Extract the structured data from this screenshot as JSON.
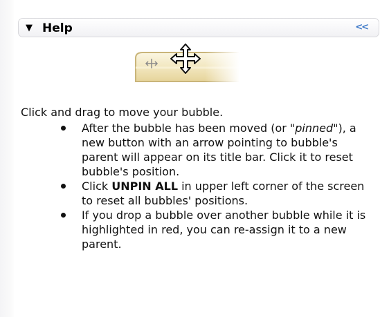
{
  "panel": {
    "title": "Help",
    "collapse_icon": "<<"
  },
  "illustration": {
    "icons": [
      "move-cross-icon",
      "move-cursor-icon"
    ]
  },
  "content": {
    "intro": "Click and drag to move your bubble.",
    "bullet1_part1": "After the bubble has been moved (or ",
    "bullet1_em": "\"pinned\"",
    "bullet1_part2": "), a new button with an arrow pointing to bubble's parent will appear on its title bar. Click it to reset bubble's position.",
    "bullet2_part1": "Click ",
    "bullet2_strong": "UNPIN ALL",
    "bullet2_part2": " in upper left corner of the screen to reset all bubbles' positions.",
    "bullet3": "If you drop a bubble over another bubble while it is highlighted in red, you can re-assign it to a new parent."
  },
  "colors": {
    "collapse_icon": "#3c78c8",
    "bubble_bar": "#f3e9c4"
  }
}
